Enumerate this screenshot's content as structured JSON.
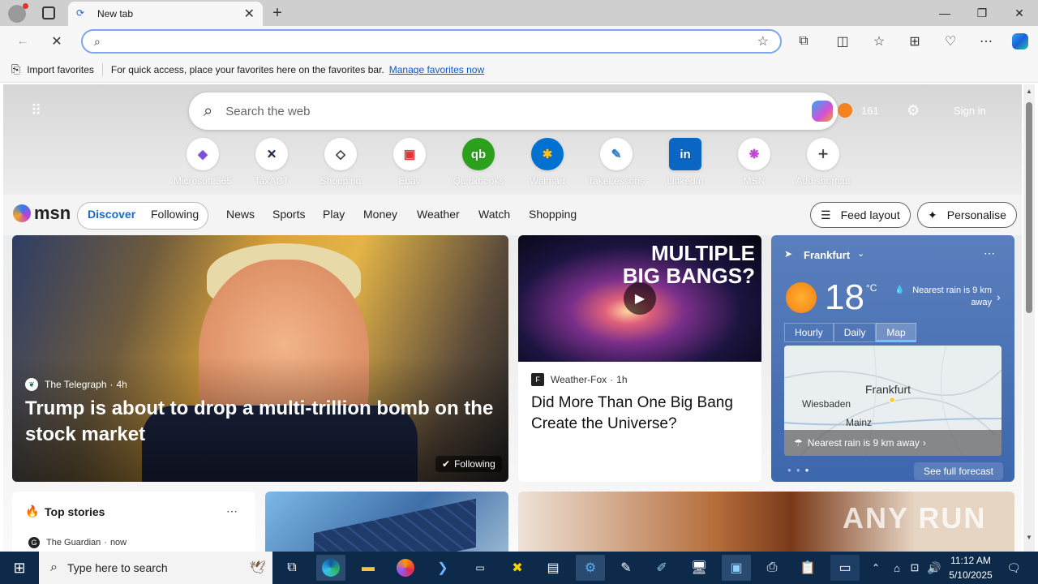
{
  "browser": {
    "tab_title": "New tab",
    "address_value": "",
    "favbar_import": "Import favorites",
    "favbar_text": "For quick access, place your favorites here on the favorites bar.",
    "favbar_link": "Manage favorites now"
  },
  "page": {
    "search_placeholder": "Search the web",
    "points": "161",
    "signin": "Sign in",
    "shortcuts": [
      {
        "label": "Microsoft 365",
        "color": "#7b4fd6",
        "glyph": "◆"
      },
      {
        "label": "TaxACT",
        "color": "#1f2a44",
        "glyph": "✕"
      },
      {
        "label": "Shopping",
        "color": "#333333",
        "glyph": "◇"
      },
      {
        "label": "Ebay",
        "color": "#e53238",
        "glyph": "▣"
      },
      {
        "label": "Quickbooks",
        "color": "#2ca01c",
        "glyph": "qb"
      },
      {
        "label": "Walmart",
        "color": "#0071ce",
        "glyph": "✱"
      },
      {
        "label": "TakeLessons",
        "color": "#2a7fc9",
        "glyph": "✎"
      },
      {
        "label": "LinkedIn",
        "color": "#0a66c2",
        "glyph": "in"
      },
      {
        "label": "MSN",
        "color": "#c03fd6",
        "glyph": "❋"
      },
      {
        "label": "Add shortcut",
        "color": "#333333",
        "glyph": "+"
      }
    ],
    "msn_logo": "msn",
    "nav_tabs": [
      "Discover",
      "Following"
    ],
    "nav_links": [
      "News",
      "Sports",
      "Play",
      "Money",
      "Weather",
      "Watch",
      "Shopping"
    ],
    "feed_layout": "Feed layout",
    "personalise": "Personalise",
    "main_story": {
      "source": "The Telegraph",
      "age": "4h",
      "title": "Trump is about to drop a multi-trillion bomb on the stock market",
      "badge": "Following"
    },
    "side_story": {
      "image_text": "MULTIPLE BIG BANGS?",
      "source": "Weather-Fox",
      "age": "1h",
      "title": "Did More Than One Big Bang Create the Universe?"
    },
    "weather": {
      "city": "Frankfurt",
      "temp": "18",
      "unit": "°C",
      "rain_note": "Nearest rain is 9 km away",
      "tabs": [
        "Hourly",
        "Daily",
        "Map"
      ],
      "map_labels": [
        "Frankfurt",
        "Wiesbaden",
        "Mainz"
      ],
      "map_banner": "Nearest rain is 9 km away",
      "forecast_link": "See full forecast"
    },
    "top_stories": {
      "title": "Top stories",
      "source": "The Guardian",
      "age": "now"
    },
    "watermark": "ANY RUN"
  },
  "taskbar": {
    "search_placeholder": "Type here to search",
    "time": "11:12 AM",
    "date": "5/10/2025"
  }
}
